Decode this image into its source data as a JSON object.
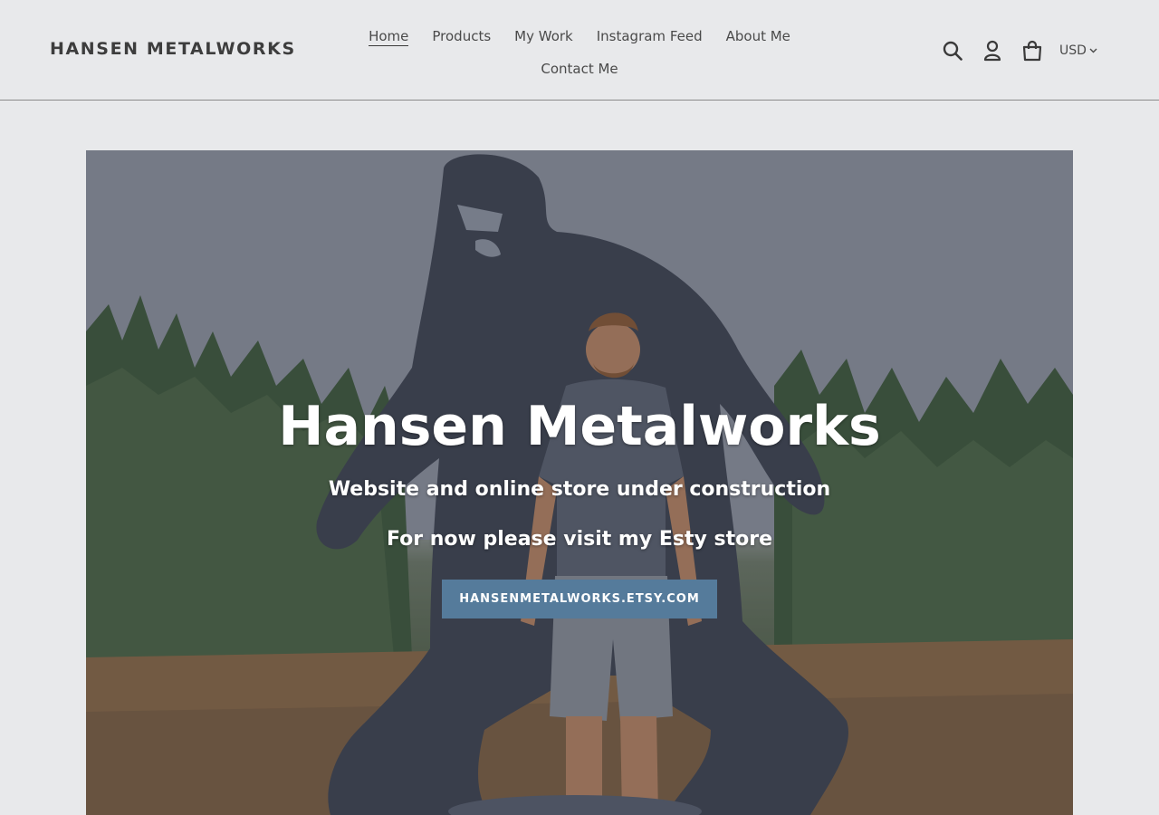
{
  "header": {
    "logo": "HANSEN METALWORKS",
    "nav": [
      {
        "label": "Home",
        "active": true
      },
      {
        "label": "Products"
      },
      {
        "label": "My Work"
      },
      {
        "label": "Instagram Feed"
      },
      {
        "label": "About Me"
      },
      {
        "label": "Contact Me"
      }
    ],
    "icons": [
      "search-icon",
      "account-icon",
      "cart-icon"
    ],
    "currency": "USD"
  },
  "hero": {
    "title": "Hansen Metalworks",
    "subtitle_1": "Website and online store under construction",
    "subtitle_2": "For now please visit my Esty store",
    "button_label": "HANSENMETALWORKS.ETSY.COM"
  },
  "colors": {
    "background": "#e8e9eb",
    "button": "#557b9b",
    "text": "#3a3a3a"
  }
}
